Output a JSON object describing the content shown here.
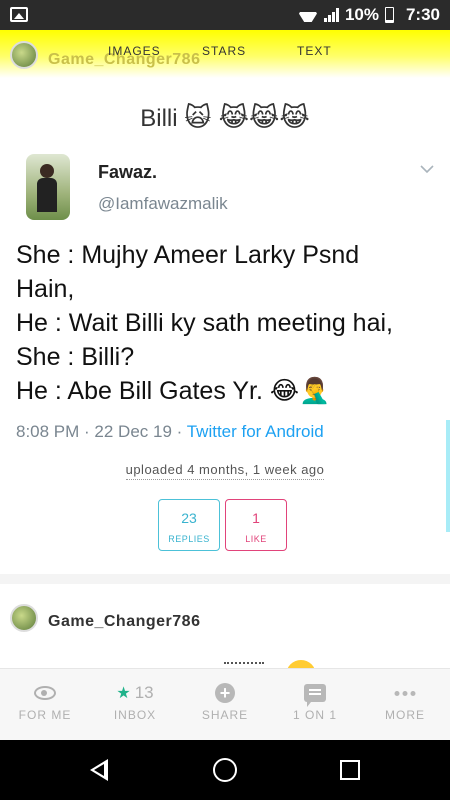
{
  "status_bar": {
    "battery": "10%",
    "time": "7:30"
  },
  "tabs": [
    "IMAGES",
    "STARS",
    "TEXT"
  ],
  "post_author": "Game_Changer786",
  "post": {
    "caption": "Billi",
    "caption_emoji": "🙀 😹😹😹",
    "tweet": {
      "name": "Fawaz.",
      "handle": "@Iamfawazmalik",
      "lines": [
        "She : Mujhy Ameer Larky Psnd",
        "Hain,",
        "He : Wait Billi ky sath meeting hai,",
        "She : Billi?",
        "He : Abe Bill Gates Yr. 😂🤦‍♂️"
      ],
      "time": "8:08 PM · 22 Dec 19 · ",
      "source": "Twitter for Android"
    },
    "uploaded": "uploaded 4 months, 1 week ago",
    "replies": {
      "count": "23",
      "label": "REPLIES"
    },
    "likes": {
      "count": "1",
      "label": "LIKE"
    }
  },
  "next_post_author": "Game_Changer786",
  "bottom_nav": [
    {
      "label": "FOR ME",
      "icon": "eye-icon"
    },
    {
      "label": "INBOX",
      "icon": "star-icon",
      "count": "13"
    },
    {
      "label": "SHARE",
      "icon": "plus-circle-icon"
    },
    {
      "label": "1 ON 1",
      "icon": "chat-icon"
    },
    {
      "label": "MORE",
      "icon": "more-dots-icon"
    }
  ],
  "colors": {
    "tab_strip": "#ffff00",
    "replies_accent": "#39b3cf",
    "likes_accent": "#e1437a",
    "twitter_blue": "#1da1f2",
    "inbox_star": "#1fb38a"
  }
}
